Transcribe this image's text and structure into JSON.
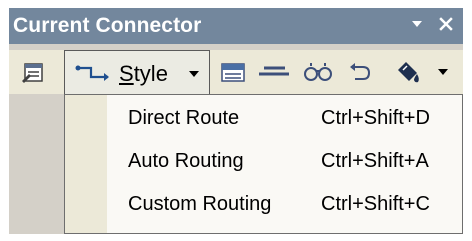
{
  "window": {
    "title": "Current Connector",
    "title_bar_color": "#73879d",
    "menu_bg_color": "#faf9f5",
    "toolbar_bg_color": "#ece9d8"
  },
  "toolbar": {
    "style_button_prefix": "",
    "style_button_underline": "S",
    "style_button_rest": "tyle",
    "icons": [
      "properties-icon",
      "connector-style-icon",
      "dropdown-arrow-icon",
      "label-icon",
      "line-icon",
      "link-icon",
      "undo-icon",
      "fill-bucket-icon",
      "fill-dropdown-icon"
    ]
  },
  "menu": {
    "items": [
      {
        "label": "Direct Route",
        "shortcut": "Ctrl+Shift+D"
      },
      {
        "label": "Auto Routing",
        "shortcut": "Ctrl+Shift+A"
      },
      {
        "label": "Custom Routing",
        "shortcut": "Ctrl+Shift+C"
      }
    ]
  }
}
